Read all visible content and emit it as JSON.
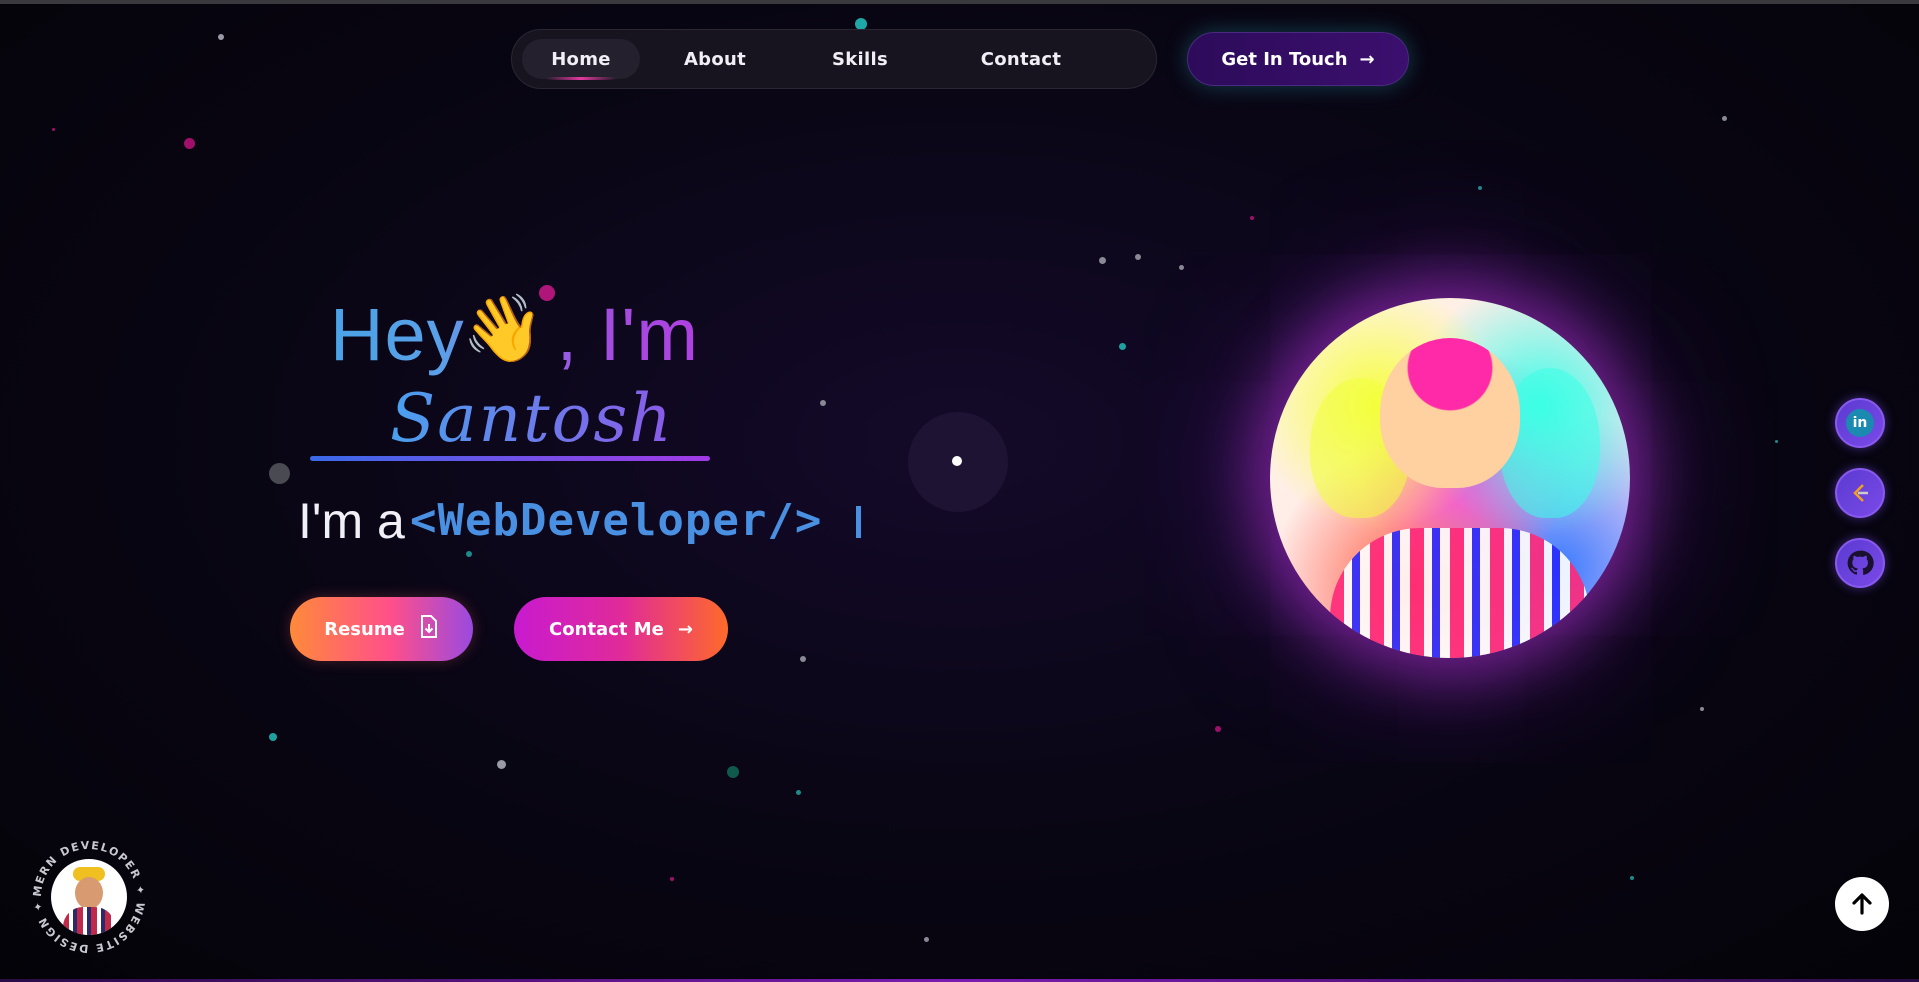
{
  "nav": {
    "items": [
      {
        "label": "Home",
        "active": true
      },
      {
        "label": "About",
        "active": false
      },
      {
        "label": "Skills",
        "active": false
      },
      {
        "label": "Contact",
        "active": false
      }
    ]
  },
  "cta": {
    "label": "Get In Touch",
    "arrow": "→"
  },
  "hero": {
    "greeting": "Hey",
    "wave": "👋",
    "greeting_suffix": ", I'm",
    "name": "Santosh",
    "role_prefix": "I'm a",
    "role": "<WebDeveloper/>",
    "resume_label": "Resume",
    "contact_label": "Contact Me",
    "contact_arrow": "→"
  },
  "socials": [
    {
      "icon": "linkedin-icon",
      "text": "in"
    },
    {
      "icon": "leetcode-icon",
      "text": ""
    },
    {
      "icon": "github-icon",
      "text": ""
    }
  ],
  "badge": {
    "ring_text": "MERN DEVELOPER ✦ WEBSITE DESIGN ✦"
  },
  "colors": {
    "background": "#0a0616",
    "accent_blue": "#4a90e2",
    "accent_purple": "#a23ae6",
    "accent_pink": "#e02a9a",
    "accent_orange": "#ff6a2a"
  }
}
